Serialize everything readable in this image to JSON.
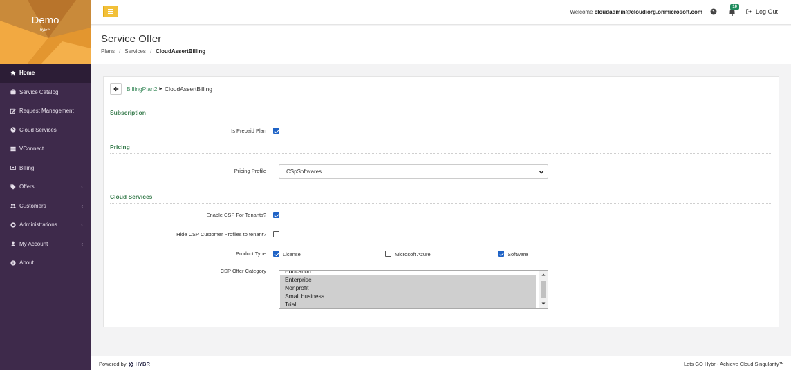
{
  "brand": {
    "title": "Demo",
    "subtitle": "Hybr™"
  },
  "sidebar": {
    "items": [
      {
        "label": "Home",
        "icon": "home-icon"
      },
      {
        "label": "Service Catalog",
        "icon": "briefcase-icon"
      },
      {
        "label": "Request Management",
        "icon": "edit-icon"
      },
      {
        "label": "Cloud Services",
        "icon": "globe-icon"
      },
      {
        "label": "VConnect",
        "icon": "server-icon"
      },
      {
        "label": "Billing",
        "icon": "money-icon"
      },
      {
        "label": "Offers",
        "icon": "tags-icon"
      },
      {
        "label": "Customers",
        "icon": "users-icon"
      },
      {
        "label": "Administrations",
        "icon": "life-ring-icon"
      },
      {
        "label": "My Account",
        "icon": "user-icon"
      },
      {
        "label": "About",
        "icon": "info-icon"
      }
    ]
  },
  "topbar": {
    "welcome_prefix": "Welcome",
    "user": "cloudadmin@cloudiorg.onmicrosoft.com",
    "notification_count": "10",
    "logout_label": "Log Out"
  },
  "header": {
    "title": "Service Offer",
    "breadcrumb": [
      "Plans",
      "Services",
      "CloudAssertBilling"
    ]
  },
  "panel": {
    "back_link": "BillingPlan2",
    "current": "CloudAssertBilling",
    "subscription": {
      "title": "Subscription",
      "prepaid_label": "Is Prepaid Plan"
    },
    "pricing": {
      "title": "Pricing",
      "profile_label": "Pricing Profile",
      "profile_value": "CSpSoftwares"
    },
    "cloud_services": {
      "title": "Cloud Services",
      "enable_csp_label": "Enable CSP For Tenants?",
      "hide_csp_label": "Hide CSP Customer Profiles to tenant?",
      "product_type_label": "Product Type",
      "product_types": [
        "License",
        "Microsoft Azure",
        "Software"
      ],
      "offer_category_label": "CSP Offer Category",
      "offer_categories": [
        "Education",
        "Enterprise",
        "Nonprofit",
        "Small business",
        "Trial"
      ]
    }
  },
  "footer": {
    "powered_by": "Powered by",
    "logo": "HYBR",
    "tagline": "Lets GO Hybr - Achieve Cloud Singularity™"
  }
}
